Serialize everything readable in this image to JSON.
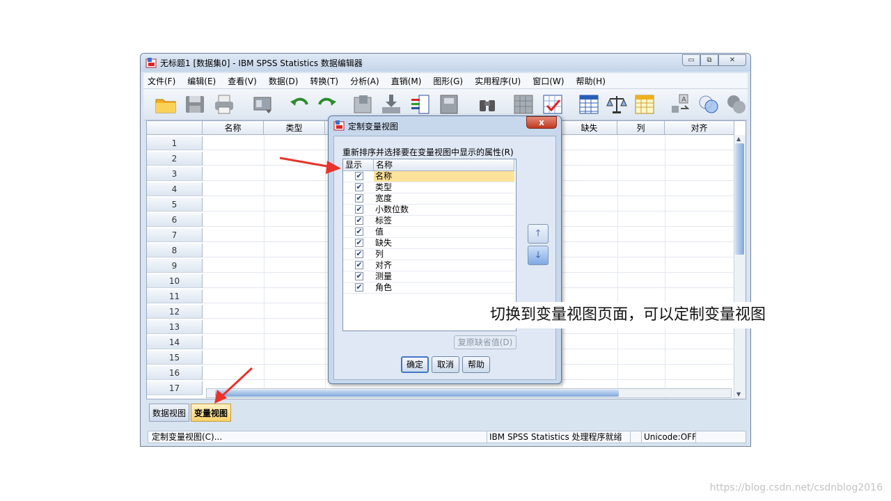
{
  "window": {
    "title": "无标题1 [数据集0] - IBM SPSS Statistics 数据编辑器",
    "min_glyph": "▭",
    "max_glyph": "⧉",
    "close_glyph": "✕"
  },
  "menubar": {
    "items": [
      "文件(F)",
      "编辑(E)",
      "查看(V)",
      "数据(D)",
      "转换(T)",
      "分析(A)",
      "直销(M)",
      "图形(G)",
      "实用程序(U)",
      "窗口(W)",
      "帮助(H)"
    ]
  },
  "toolbar": {
    "icons": [
      "open-folder-icon",
      "save-icon",
      "print-icon",
      "dialog-recall-icon",
      "undo-icon",
      "redo-icon",
      "goto-case-icon",
      "goto-variable-icon",
      "variables-icon",
      "run-descriptives-icon",
      "find-icon",
      "insert-cases-icon",
      "insert-variable-icon",
      "split-file-icon",
      "weight-cases-icon",
      "select-cases-icon",
      "value-labels-icon",
      "use-sets-icon",
      "show-all-icon"
    ]
  },
  "grid": {
    "columns": [
      "名称",
      "类型",
      "缺失",
      "列",
      "对齐"
    ],
    "rows": [
      "1",
      "2",
      "3",
      "4",
      "5",
      "6",
      "7",
      "8",
      "9",
      "10",
      "11",
      "12",
      "13",
      "14",
      "15",
      "16",
      "17"
    ]
  },
  "tabs": {
    "data_view": "数据视图",
    "variable_view": "变量视图"
  },
  "statusbar": {
    "left": "定制变量视图(C)...",
    "processor": "IBM SPSS Statistics 处理程序就绪",
    "unicode": "Unicode:OFF"
  },
  "dialog": {
    "title": "定制变量视图",
    "close_label": "x",
    "instruction": "重新排序并选择要在变量视图中显示的属性(R)",
    "col_show": "显示",
    "col_name": "名称",
    "attributes": [
      {
        "name": "名称",
        "checked": true,
        "selected": true
      },
      {
        "name": "类型",
        "checked": true
      },
      {
        "name": "宽度",
        "checked": true
      },
      {
        "name": "小数位数",
        "checked": true
      },
      {
        "name": "标签",
        "checked": true
      },
      {
        "name": "值",
        "checked": true
      },
      {
        "name": "缺失",
        "checked": true
      },
      {
        "name": "列",
        "checked": true
      },
      {
        "name": "对齐",
        "checked": true
      },
      {
        "name": "测量",
        "checked": true
      },
      {
        "name": "角色",
        "checked": true
      }
    ],
    "check_glyph": "✔",
    "up_glyph": "🡑",
    "down_glyph": "🡓",
    "restore_label": "复原缺省值(D)",
    "ok_label": "确定",
    "cancel_label": "取消",
    "help_label": "帮助"
  },
  "annotation": {
    "callout": "切换到变量视图页面，可以定制变量视图",
    "arrow_color": "#e8332a"
  },
  "watermark": "https://blog.csdn.net/csdnblog2016"
}
